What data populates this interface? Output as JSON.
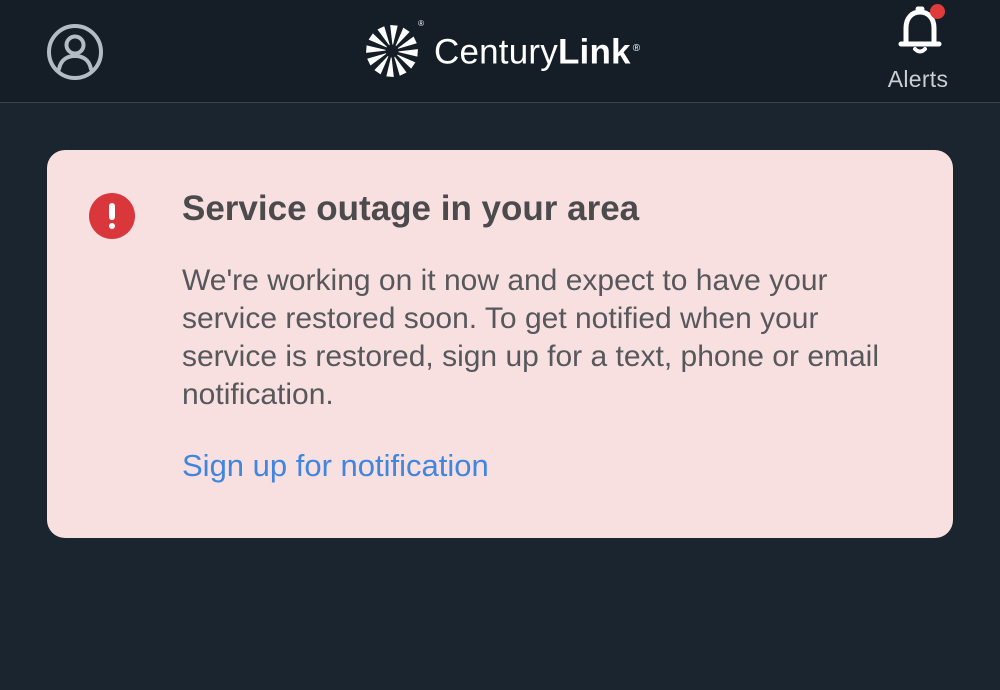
{
  "header": {
    "profile_icon": "user-circle-icon",
    "brand": {
      "logo_icon": "centurylink-starburst-logo",
      "name_first": "Century",
      "name_second": "Link",
      "registered_mark": "®"
    },
    "alerts": {
      "icon": "bell-icon",
      "label": "Alerts",
      "has_unread": true
    }
  },
  "alert_card": {
    "icon": "exclamation-circle-icon",
    "title": "Service outage in your area",
    "body": "We're working on it now and expect to have your service restored soon. To get notified when your service is restored, sign up for a text, phone or email notification.",
    "link_label": "Sign up for notification"
  },
  "colors": {
    "page_background": "#1b2530",
    "header_background": "#151e26",
    "card_background": "#f8dfe0",
    "error_red": "#d9373c",
    "link_blue": "#3f86de",
    "unread_dot": "#e03a3a"
  }
}
